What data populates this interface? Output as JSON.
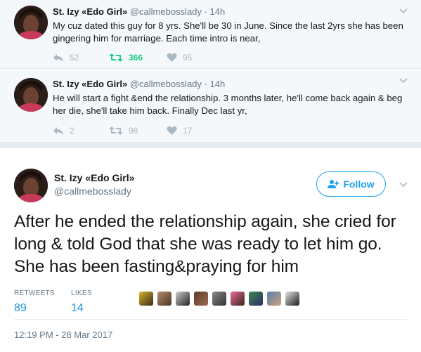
{
  "thread": [
    {
      "name": "St. Izy «Edo Girl»",
      "handle": "@callmebosslady",
      "separator": "·",
      "time": "14h",
      "text": "My cuz dated this guy for 8 yrs. She'll be 30 in June. Since the last 2yrs she has been gingering him for marriage. Each time intro is near,",
      "replies": "52",
      "retweets": "366",
      "likes": "95",
      "retweeted": true
    },
    {
      "name": "St. Izy «Edo Girl»",
      "handle": "@callmebosslady",
      "separator": "·",
      "time": "14h",
      "text": "He will start a fight &end the relationship. 3 months later, he'll come back again & beg her die, she'll take him back. Finally Dec last yr,",
      "replies": "2",
      "retweets": "98",
      "likes": "17",
      "retweeted": false
    }
  ],
  "main": {
    "name": "St. Izy «Edo Girl»",
    "handle": "@callmebosslady",
    "follow_label": "Follow",
    "text": "After he ended the relationship again, she cried for long & told God that she was ready to let him go. She has been fasting&praying for him",
    "retweets_label": "RETWEETS",
    "retweets_value": "89",
    "likes_label": "LIKES",
    "likes_value": "14",
    "timestamp": "12:19 PM - 28 Mar 2017"
  },
  "colors": {
    "accent": "#1da1f2",
    "retweet_active": "#19cf86",
    "muted": "#657786",
    "icon": "#aab8c2"
  },
  "icons": [
    "reply-icon",
    "retweet-icon",
    "heart-icon",
    "chevron-down-icon",
    "add-user-icon"
  ]
}
